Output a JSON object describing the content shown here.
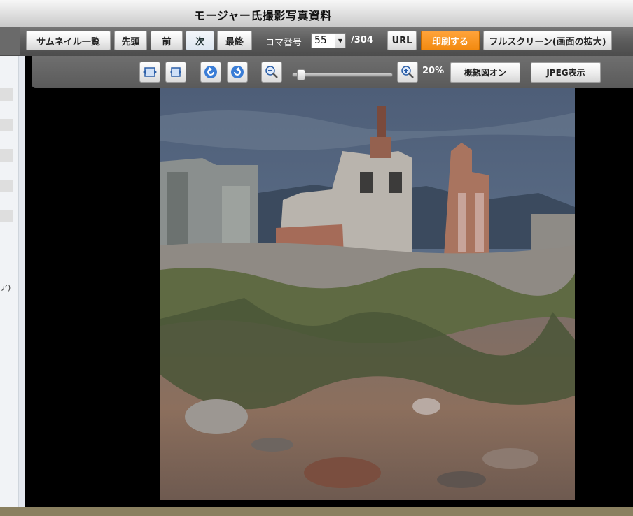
{
  "window": {
    "title": "モージャー氏撮影写真資料"
  },
  "toolbar": {
    "thumbnails_label": "サムネイル一覧",
    "first_label": "先頭",
    "prev_label": "前",
    "next_label": "次",
    "last_label": "最終",
    "frame_label": "コマ番号",
    "frame_value": "55",
    "frame_total": "/304",
    "url_label": "URL",
    "print_label": "印刷する",
    "fullscreen_label": "フルスクリーン(画面の拡大)"
  },
  "viewer_controls": {
    "zoom_percent": "20%",
    "overview_label": "概観図オン",
    "jpeg_label": "JPEG表示",
    "slider_level": 0.05
  },
  "sidebar": {
    "paren_text": "ア)"
  },
  "colors": {
    "print_accent": "#f28a10",
    "viewer_bg": "#000000",
    "toolbar_bg": "#5c5c5c"
  },
  "icons": [
    "fit-width-icon",
    "fit-height-icon",
    "rotate-left-icon",
    "rotate-right-icon",
    "zoom-out-icon",
    "zoom-in-icon"
  ]
}
